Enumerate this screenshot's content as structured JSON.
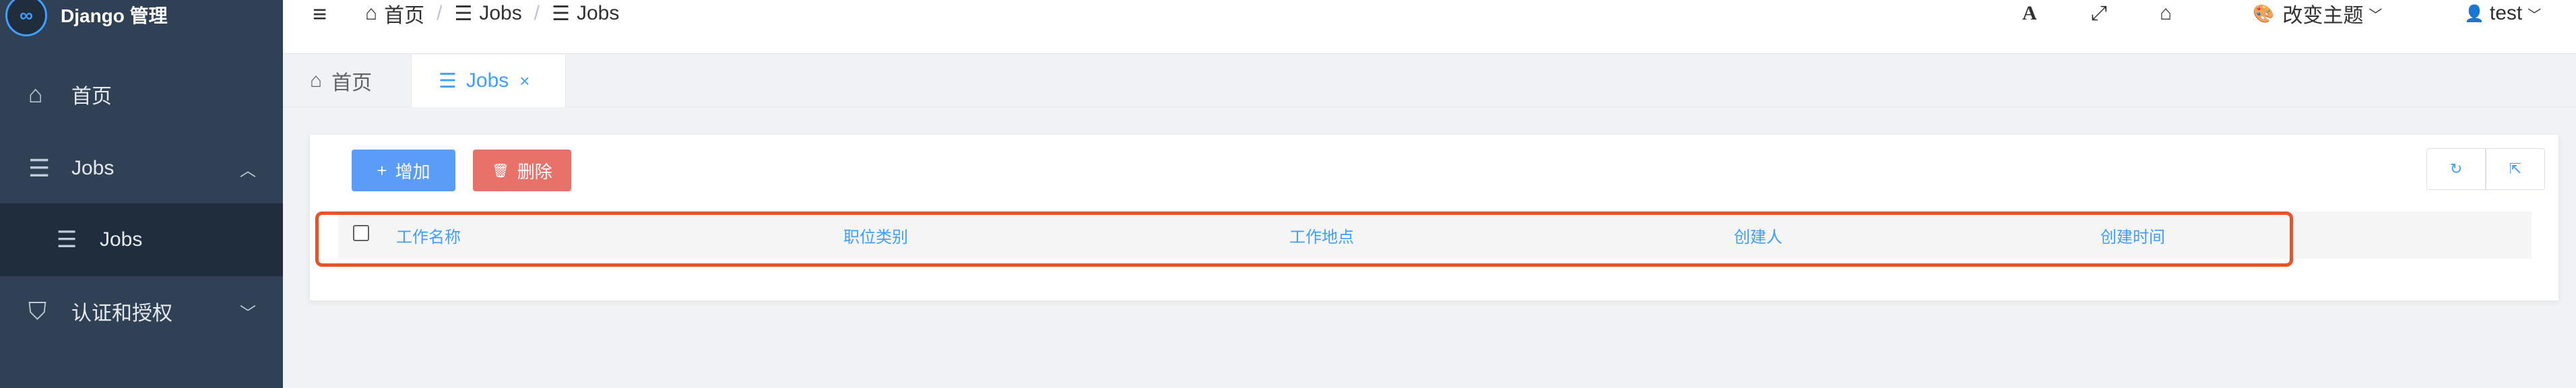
{
  "brand": {
    "title": "Django 管理",
    "logo": "∞"
  },
  "sidebar": {
    "items": [
      {
        "label": "首页",
        "icon": "home-icon",
        "glyph": "⌂"
      },
      {
        "label": "Jobs",
        "icon": "list-icon",
        "glyph": "☰",
        "arrow": "︿"
      },
      {
        "label": "认证和授权",
        "icon": "shield-icon",
        "glyph": "⛉",
        "arrow": "﹀"
      }
    ],
    "sub_items": [
      {
        "label": "Jobs",
        "icon": "list-icon",
        "glyph": "☰"
      }
    ]
  },
  "navbar": {
    "menu_glyph": "≡",
    "breadcrumb": [
      {
        "label": "首页",
        "glyph": "⌂"
      },
      {
        "label": "Jobs",
        "glyph": "☰"
      },
      {
        "label": "Jobs",
        "glyph": "☰"
      }
    ],
    "separator": "/",
    "font_glyph": "A",
    "fullscreen_glyph": "⤢",
    "home_glyph": "⌂",
    "theme_label": "改变主题",
    "theme_glyph": "🎨",
    "user_label": "test",
    "user_glyph": "👤",
    "caret": "﹀"
  },
  "tabs": [
    {
      "label": "首页",
      "glyph": "⌂"
    },
    {
      "label": "Jobs",
      "glyph": "☰",
      "close": "×"
    }
  ],
  "toolbar": {
    "add_label": "增加",
    "add_glyph": "+",
    "delete_label": "删除",
    "delete_glyph": "🗑",
    "refresh_glyph": "↻",
    "export_glyph": "⇱"
  },
  "table": {
    "columns": [
      "工作名称",
      "职位类别",
      "工作地点",
      "创建人",
      "创建时间"
    ]
  },
  "colors": {
    "sidebar_bg": "#304156",
    "primary": "#409eff",
    "add_button": "#5a9cf8",
    "delete_button": "#e8716a",
    "highlight_border": "#e8542a"
  }
}
